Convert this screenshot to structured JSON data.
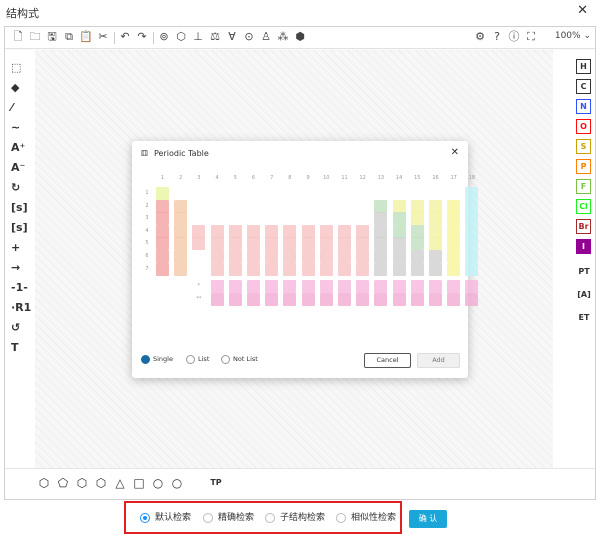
{
  "window": {
    "title": "结构式",
    "close_glyph": "✕"
  },
  "toolbar": {
    "icons": [
      "new-document-icon",
      "open-folder-icon",
      "save-icon",
      "copy-icon",
      "paste-icon",
      "cut-icon",
      "undo-icon",
      "redo-icon",
      "aromatize-icon",
      "dearomatize-icon",
      "layout-icon",
      "clean-icon",
      "stereo-icon",
      "check-structure-icon",
      "analyze-icon",
      "chemical-3d-icon",
      "template-icon"
    ],
    "right_icons": [
      "settings-icon",
      "help-icon",
      "about-icon",
      "fullscreen-icon"
    ],
    "zoom": "100%"
  },
  "left_tools": [
    {
      "name": "select-lasso-tool",
      "glyph": "⬚"
    },
    {
      "name": "eraser-tool",
      "glyph": "◆"
    },
    {
      "name": "single-bond-tool",
      "glyph": "⁄"
    },
    {
      "name": "chain-tool",
      "glyph": "∼"
    },
    {
      "name": "charge-plus-tool",
      "glyph": "A⁺"
    },
    {
      "name": "charge-minus-tool",
      "glyph": "A⁻"
    },
    {
      "name": "rotate-tool",
      "glyph": "↻"
    },
    {
      "name": "s-group-tool",
      "glyph": "[s]"
    },
    {
      "name": "data-s-group-tool",
      "glyph": "[s]"
    },
    {
      "name": "reaction-plus-tool",
      "glyph": "+"
    },
    {
      "name": "reaction-arrow-tool",
      "glyph": "→"
    },
    {
      "name": "reaction-mapping-tool",
      "glyph": "-1-"
    },
    {
      "name": "r-group-tool",
      "glyph": "·R1"
    },
    {
      "name": "attachment-point-tool",
      "glyph": "↺"
    },
    {
      "name": "text-tool",
      "glyph": "T"
    }
  ],
  "right_atoms": [
    {
      "label": "H",
      "color": "#333333"
    },
    {
      "label": "C",
      "color": "#333333"
    },
    {
      "label": "N",
      "color": "#3050f8"
    },
    {
      "label": "O",
      "color": "#ff0d0d"
    },
    {
      "label": "S",
      "color": "#c8a000"
    },
    {
      "label": "P",
      "color": "#ff8000"
    },
    {
      "label": "F",
      "color": "#7ac143"
    },
    {
      "label": "Cl",
      "color": "#1ff01f"
    },
    {
      "label": "Br",
      "color": "#a62929"
    },
    {
      "label": "I",
      "color": "#940094"
    }
  ],
  "right_extra": [
    "PT",
    "[A]",
    "ET"
  ],
  "bottom_shapes": [
    "⬡",
    "⬠",
    "⬡",
    "⬡",
    "△",
    "□",
    "○",
    "○"
  ],
  "bottom_template_label": "TP",
  "periodic_table": {
    "title": "Periodic Table",
    "close_glyph": "✕",
    "groups": [
      "1",
      "2",
      "3",
      "4",
      "5",
      "6",
      "7",
      "8",
      "9",
      "10",
      "11",
      "12",
      "13",
      "14",
      "15",
      "16",
      "17",
      "18"
    ],
    "periods": [
      "1",
      "2",
      "3",
      "4",
      "5",
      "6",
      "7"
    ],
    "mode_options": [
      "Single",
      "List",
      "Not List"
    ],
    "selected_mode": "Single",
    "cancel_label": "Cancel",
    "add_label": "Add",
    "lanthanide_marker": "*",
    "actinide_marker": "**"
  },
  "search": {
    "options": [
      "默认检索",
      "精确检索",
      "子结构检索",
      "相似性检索"
    ],
    "selected": "默认检索",
    "confirm_label": "确 认"
  }
}
